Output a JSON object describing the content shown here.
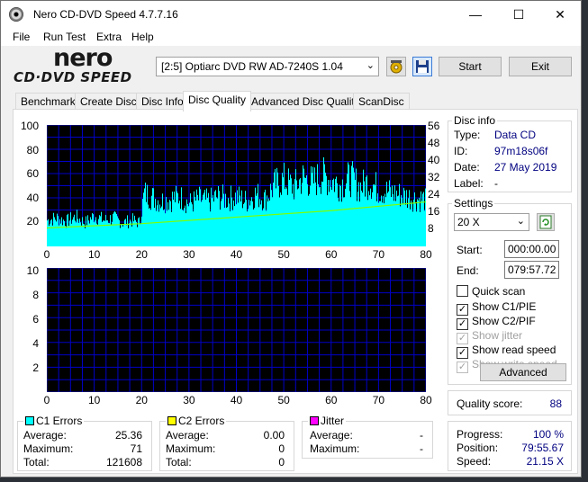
{
  "window": {
    "title": "Nero CD-DVD Speed 4.7.7.16",
    "minimize": "—",
    "maximize": "☐",
    "close": "✕"
  },
  "menu": [
    "File",
    "Run Test",
    "Extra",
    "Help"
  ],
  "logo": {
    "brand": "nero",
    "product": "CD·DVD SPEED"
  },
  "toolbar": {
    "drive": "[2:5]   Optiarc DVD RW AD-7240S 1.04",
    "start_label": "Start",
    "exit_label": "Exit"
  },
  "tabs": [
    "Benchmark",
    "Create Disc",
    "Disc Info",
    "Disc Quality",
    "Advanced Disc Quality",
    "ScanDisc"
  ],
  "active_tab": "Disc Quality",
  "disc_info": {
    "title": "Disc info",
    "type_label": "Type:",
    "type_value": "Data CD",
    "id_label": "ID:",
    "id_value": "97m18s06f",
    "date_label": "Date:",
    "date_value": "27 May 2019",
    "label_label": "Label:",
    "label_value": "-"
  },
  "settings": {
    "title": "Settings",
    "speed": "20 X",
    "start_label": "Start:",
    "start_value": "000:00.00",
    "end_label": "End:",
    "end_value": "079:57.72",
    "quick_scan": "Quick scan",
    "show_c1pie": "Show C1/PIE",
    "show_c2pif": "Show C2/PIF",
    "show_jitter": "Show jitter",
    "show_read_speed": "Show read speed",
    "show_write_speed": "Show write speed",
    "advanced_label": "Advanced"
  },
  "quality": {
    "label": "Quality score:",
    "value": "88"
  },
  "progress": {
    "progress_label": "Progress:",
    "progress_value": "100 %",
    "position_label": "Position:",
    "position_value": "79:55.67",
    "speed_label": "Speed:",
    "speed_value": "21.15 X"
  },
  "c1": {
    "title": "C1 Errors",
    "average_label": "Average:",
    "average_value": "25.36",
    "maximum_label": "Maximum:",
    "maximum_value": "71",
    "total_label": "Total:",
    "total_value": "121608"
  },
  "c2": {
    "title": "C2 Errors",
    "average_label": "Average:",
    "average_value": "0.00",
    "maximum_label": "Maximum:",
    "maximum_value": "0",
    "total_label": "Total:",
    "total_value": "0"
  },
  "jitter": {
    "title": "Jitter",
    "average_label": "Average:",
    "average_value": "-",
    "maximum_label": "Maximum:",
    "maximum_value": "-"
  },
  "colors": {
    "c1": "#00ffff",
    "c2": "#ffff00",
    "jitter": "#ff00ff",
    "speed_line": "#7fff00",
    "grid": "#0000c8",
    "plot_bg": "#000000"
  },
  "chart_data": [
    {
      "type": "area",
      "name_series": "C1 Errors",
      "x_ticks": [
        0,
        10,
        20,
        30,
        40,
        50,
        60,
        70,
        80
      ],
      "y_ticks_left": [
        20,
        40,
        60,
        80,
        100
      ],
      "y_ticks_right": [
        8,
        16,
        24,
        32,
        40,
        48,
        56
      ],
      "xlim": [
        0,
        80
      ],
      "ylim": [
        0,
        100
      ],
      "ylim_right": [
        0,
        56
      ],
      "c1_envelope": {
        "x": [
          0,
          2,
          4,
          6,
          8,
          10,
          12,
          14,
          16,
          18,
          19.5,
          20.5,
          22,
          24,
          26,
          28,
          30,
          32,
          34,
          36,
          38,
          40,
          42,
          44,
          46,
          48,
          50,
          52,
          54,
          56,
          58,
          60,
          62,
          64,
          66,
          68,
          70,
          72,
          74,
          76,
          78,
          79.5,
          80
        ],
        "y": [
          22,
          24,
          21,
          25,
          20,
          26,
          22,
          24,
          20,
          22,
          20,
          45,
          42,
          38,
          40,
          42,
          36,
          40,
          38,
          42,
          40,
          42,
          38,
          44,
          40,
          52,
          56,
          50,
          58,
          54,
          60,
          56,
          52,
          58,
          50,
          55,
          48,
          46,
          44,
          42,
          40,
          40,
          38
        ]
      },
      "read_speed": {
        "x": [
          0,
          20,
          40,
          60,
          80
        ],
        "y": [
          8.5,
          10.5,
          13.5,
          16.5,
          20.5
        ]
      }
    },
    {
      "type": "area",
      "name_series": "C2 Errors",
      "x_ticks": [
        0,
        10,
        20,
        30,
        40,
        50,
        60,
        70,
        80
      ],
      "y_ticks_left": [
        2,
        4,
        6,
        8,
        10
      ],
      "xlim": [
        0,
        80
      ],
      "ylim": [
        0,
        10
      ],
      "values": []
    }
  ]
}
